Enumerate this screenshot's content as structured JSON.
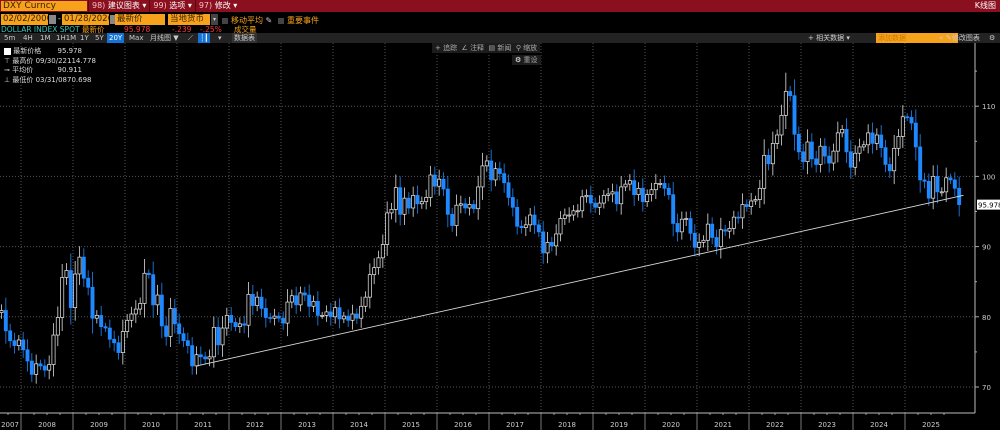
{
  "topbar": {
    "ticker": "DXY Curncy",
    "menus": [
      {
        "num": "98)",
        "label": "建议图表"
      },
      {
        "num": "99)",
        "label": "选项"
      },
      {
        "num": "97)",
        "label": "修改"
      }
    ],
    "chart_type_title": "K线图"
  },
  "controls": {
    "start_date": "02/02/2006",
    "end_date": "01/28/2026",
    "date_sep": "-",
    "field": "最新价",
    "currency": "当地货币",
    "moving_avg": "移动平均",
    "events": "重要事件"
  },
  "quote": {
    "name": "DOLLAR INDEX SPOT",
    "last_label": "最新价",
    "last": "95.978",
    "change": "-.239",
    "change_pct": "-.25%",
    "volume_label": "成交量"
  },
  "toolbar": {
    "periods": [
      "5m",
      "4H",
      "1M",
      "1H1M",
      "1Y",
      "5Y",
      "20Y",
      "Max"
    ],
    "active_period": "20Y",
    "frequency": "月线图",
    "data_table": "数据表",
    "related_data": "相关数据",
    "add_data_placeholder": "添加数据",
    "edit_chart": "修改图表"
  },
  "overlay": {
    "track": "追踪",
    "annotate": "注释",
    "news": "新闻",
    "zoom": "缩放",
    "reset": "重设"
  },
  "legend": {
    "last_label": "最新价格",
    "last_value": "95.978",
    "high_label": "最高价",
    "high_date": "09/30/22",
    "high_value": "114.778",
    "avg_label": "平均价",
    "avg_value": "90.911",
    "low_label": "最低价",
    "low_date": "03/31/08",
    "low_value": "70.698"
  },
  "chart_data": {
    "type": "candlestick",
    "frequency": "monthly",
    "up_color": "#ffffff",
    "down_color": "#1e88ff",
    "ylim": [
      65,
      118
    ],
    "yticks": [
      70,
      80,
      90,
      100,
      110
    ],
    "xticks": [
      "2007",
      "2008",
      "2009",
      "2010",
      "2011",
      "2012",
      "2013",
      "2014",
      "2015",
      "2016",
      "2017",
      "2018",
      "2019",
      "2020",
      "2021",
      "2022",
      "2023",
      "2024",
      "2025"
    ],
    "grid": true,
    "last_price_label": "95.978",
    "first_month": "2007-07",
    "closes": [
      80.6,
      80.9,
      78.0,
      76.6,
      75.9,
      76.7,
      75.3,
      73.7,
      71.8,
      73.3,
      73.0,
      72.4,
      73.2,
      77.4,
      79.9,
      85.6,
      86.6,
      81.3,
      86.1,
      88.5,
      85.5,
      84.2,
      79.8,
      80.2,
      78.6,
      78.4,
      76.8,
      76.3,
      74.9,
      77.9,
      79.5,
      80.4,
      81.1,
      81.9,
      86.2,
      86.0,
      81.7,
      83.1,
      78.7,
      77.2,
      81.2,
      79.0,
      77.6,
      76.6,
      75.9,
      73.0,
      74.6,
      74.3,
      74.0,
      74.3,
      78.5,
      76.0,
      78.4,
      80.2,
      79.2,
      78.6,
      79.0,
      78.8,
      83.2,
      81.6,
      82.8,
      81.2,
      79.9,
      79.8,
      80.1,
      79.8,
      79.1,
      82.1,
      83.0,
      81.7,
      83.4,
      83.1,
      81.5,
      82.2,
      80.2,
      80.2,
      80.7,
      80.0,
      81.3,
      79.7,
      80.1,
      79.5,
      80.4,
      79.8,
      81.5,
      82.8,
      86.0,
      87.0,
      88.4,
      90.3,
      94.8,
      95.3,
      98.4,
      94.6,
      96.9,
      95.5,
      97.3,
      96.1,
      96.4,
      97.0,
      100.2,
      98.6,
      99.6,
      98.2,
      94.6,
      93.0,
      95.9,
      96.1,
      95.5,
      96.0,
      95.4,
      98.5,
      101.5,
      102.2,
      99.5,
      101.1,
      100.4,
      99.1,
      97.0,
      95.6,
      92.9,
      92.7,
      93.1,
      94.5,
      93.1,
      92.1,
      89.1,
      90.6,
      90.1,
      91.8,
      94.0,
      94.5,
      94.5,
      95.1,
      95.1,
      97.1,
      97.3,
      96.2,
      95.6,
      96.2,
      97.3,
      97.5,
      97.8,
      96.1,
      98.5,
      98.9,
      99.4,
      97.4,
      98.3,
      96.4,
      97.4,
      98.1,
      99.0,
      99.0,
      98.3,
      97.4,
      93.3,
      92.1,
      93.9,
      94.0,
      91.9,
      89.9,
      90.6,
      90.9,
      93.2,
      91.3,
      90.0,
      92.4,
      92.2,
      92.6,
      94.2,
      94.1,
      96.0,
      95.7,
      96.5,
      96.7,
      98.3,
      103.0,
      101.8,
      104.7,
      105.9,
      108.7,
      112.1,
      111.5,
      106.0,
      103.5,
      102.1,
      104.9,
      102.5,
      101.7,
      104.3,
      102.9,
      101.9,
      103.6,
      106.2,
      106.7,
      103.5,
      101.3,
      103.3,
      104.2,
      104.5,
      106.2,
      104.7,
      105.9,
      104.1,
      101.7,
      100.8,
      104.0,
      105.7,
      108.5,
      108.4,
      107.6,
      104.2,
      99.5,
      99.3,
      96.9,
      100.0,
      97.8,
      97.8,
      99.8,
      99.5,
      98.3,
      95.978
    ],
    "trendline": {
      "start": [
        "2011-05",
        73.0
      ],
      "end": [
        "2026-02",
        97.3
      ]
    }
  }
}
